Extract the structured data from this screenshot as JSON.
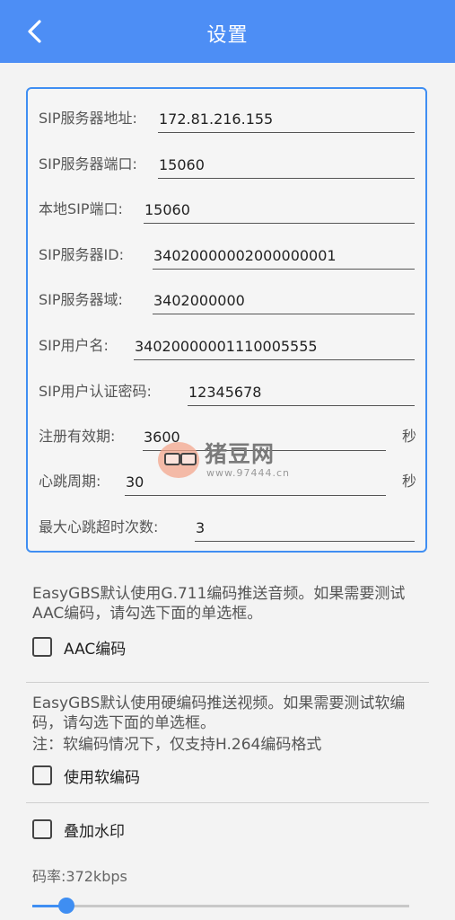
{
  "header": {
    "title": "设置",
    "back_icon": "chevron-left-icon",
    "background": "#4d8ef5"
  },
  "sip_settings": {
    "server_address": {
      "label": "SIP服务器地址:",
      "value": "172.81.216.155"
    },
    "server_port": {
      "label": "SIP服务器端口:",
      "value": "15060"
    },
    "local_port": {
      "label": "本地SIP端口:",
      "value": "15060"
    },
    "server_id": {
      "label": "SIP服务器ID:",
      "value": "34020000002000000001"
    },
    "server_domain": {
      "label": "SIP服务器域:",
      "value": "3402000000"
    },
    "username": {
      "label": "SIP用户名:",
      "value": "34020000001110005555"
    },
    "auth_password": {
      "label": "SIP用户认证密码:",
      "value": "12345678"
    },
    "register_expiry": {
      "label": "注册有效期:",
      "value": "3600",
      "unit": "秒"
    },
    "heartbeat_period": {
      "label": "心跳周期:",
      "value": "30",
      "unit": "秒"
    },
    "max_heartbeat_timeouts": {
      "label": "最大心跳超时次数:",
      "value": "3"
    }
  },
  "audio_note": "EasyGBS默认使用G.711编码推送音频。如果需要测试AAC编码，请勾选下面的单选框。",
  "aac_option": {
    "label": "AAC编码",
    "checked": false
  },
  "video_note_line1": "EasyGBS默认使用硬编码推送视频。如果需要测试软编码，请勾选下面的单选框。",
  "video_note_line2": "注：软编码情况下，仅支持H.264编码格式",
  "soft_encode_option": {
    "label": "使用软编码",
    "checked": false
  },
  "watermark_option": {
    "label": "叠加水印",
    "checked": false
  },
  "bitrate": {
    "label": "码率:372kbps",
    "slider_fraction": 0.09
  },
  "watermark_overlay": {
    "title": "猪豆网",
    "url": "www.97444.cn"
  },
  "colors": {
    "accent": "#3f8ef2"
  }
}
